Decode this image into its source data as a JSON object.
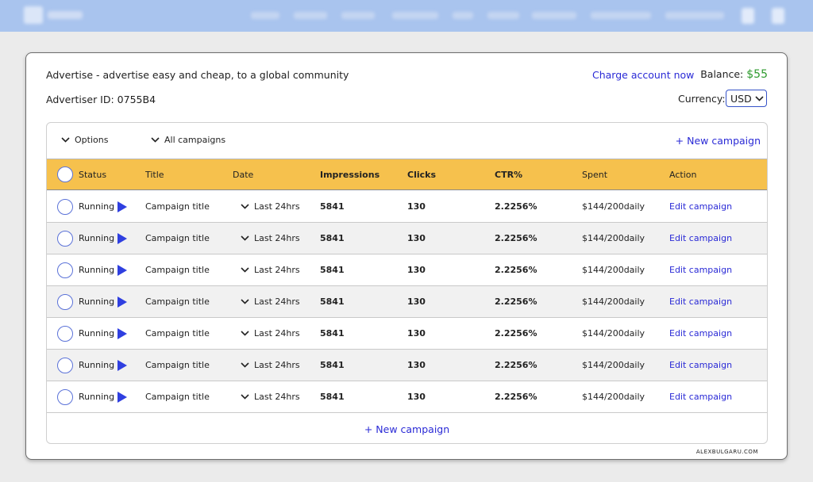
{
  "header": {
    "intro": "Advertise - advertise easy and cheap, to a global community",
    "advertiser_id": "Advertiser ID: 0755B4",
    "charge_label": "Charge account now",
    "balance_label": "Balance:",
    "balance_amount": "$55",
    "currency_label": "Currency:",
    "currency_value": "USD"
  },
  "toolbar": {
    "options_label": "Options",
    "campaigns_filter_label": "All campaigns",
    "new_campaign_label": "+ New campaign"
  },
  "table": {
    "columns": [
      "Status",
      "Title",
      "Date",
      "Impressions",
      "Clicks",
      "CTR%",
      "Spent",
      "Action"
    ],
    "rows": [
      {
        "status": "Running",
        "title": "Campaign title",
        "date": "Last 24hrs",
        "impressions": "5841",
        "clicks": "130",
        "ctr": "2.2256%",
        "spent": "$144/200daily",
        "action": "Edit campaign"
      },
      {
        "status": "Running",
        "title": "Campaign title",
        "date": "Last 24hrs",
        "impressions": "5841",
        "clicks": "130",
        "ctr": "2.2256%",
        "spent": "$144/200daily",
        "action": "Edit campaign"
      },
      {
        "status": "Running",
        "title": "Campaign title",
        "date": "Last 24hrs",
        "impressions": "5841",
        "clicks": "130",
        "ctr": "2.2256%",
        "spent": "$144/200daily",
        "action": "Edit campaign"
      },
      {
        "status": "Running",
        "title": "Campaign title",
        "date": "Last 24hrs",
        "impressions": "5841",
        "clicks": "130",
        "ctr": "2.2256%",
        "spent": "$144/200daily",
        "action": "Edit campaign"
      },
      {
        "status": "Running",
        "title": "Campaign title",
        "date": "Last 24hrs",
        "impressions": "5841",
        "clicks": "130",
        "ctr": "2.2256%",
        "spent": "$144/200daily",
        "action": "Edit campaign"
      },
      {
        "status": "Running",
        "title": "Campaign title",
        "date": "Last 24hrs",
        "impressions": "5841",
        "clicks": "130",
        "ctr": "2.2256%",
        "spent": "$144/200daily",
        "action": "Edit campaign"
      },
      {
        "status": "Running",
        "title": "Campaign title",
        "date": "Last 24hrs",
        "impressions": "5841",
        "clicks": "130",
        "ctr": "2.2256%",
        "spent": "$144/200daily",
        "action": "Edit campaign"
      }
    ]
  },
  "footer": {
    "new_campaign_label": "+ New campaign",
    "credit": "ALEXBULGARU.COM"
  },
  "colors": {
    "header_bar": "#a9c4ee",
    "table_header": "#f6c14d",
    "link": "#2a2ad6",
    "balance": "#2f9b2f",
    "play_icon": "#2f3fe0"
  },
  "icons": {
    "status_running": "play-icon",
    "dropdown": "chevron-down-icon",
    "select": "checkbox-circle-icon"
  }
}
